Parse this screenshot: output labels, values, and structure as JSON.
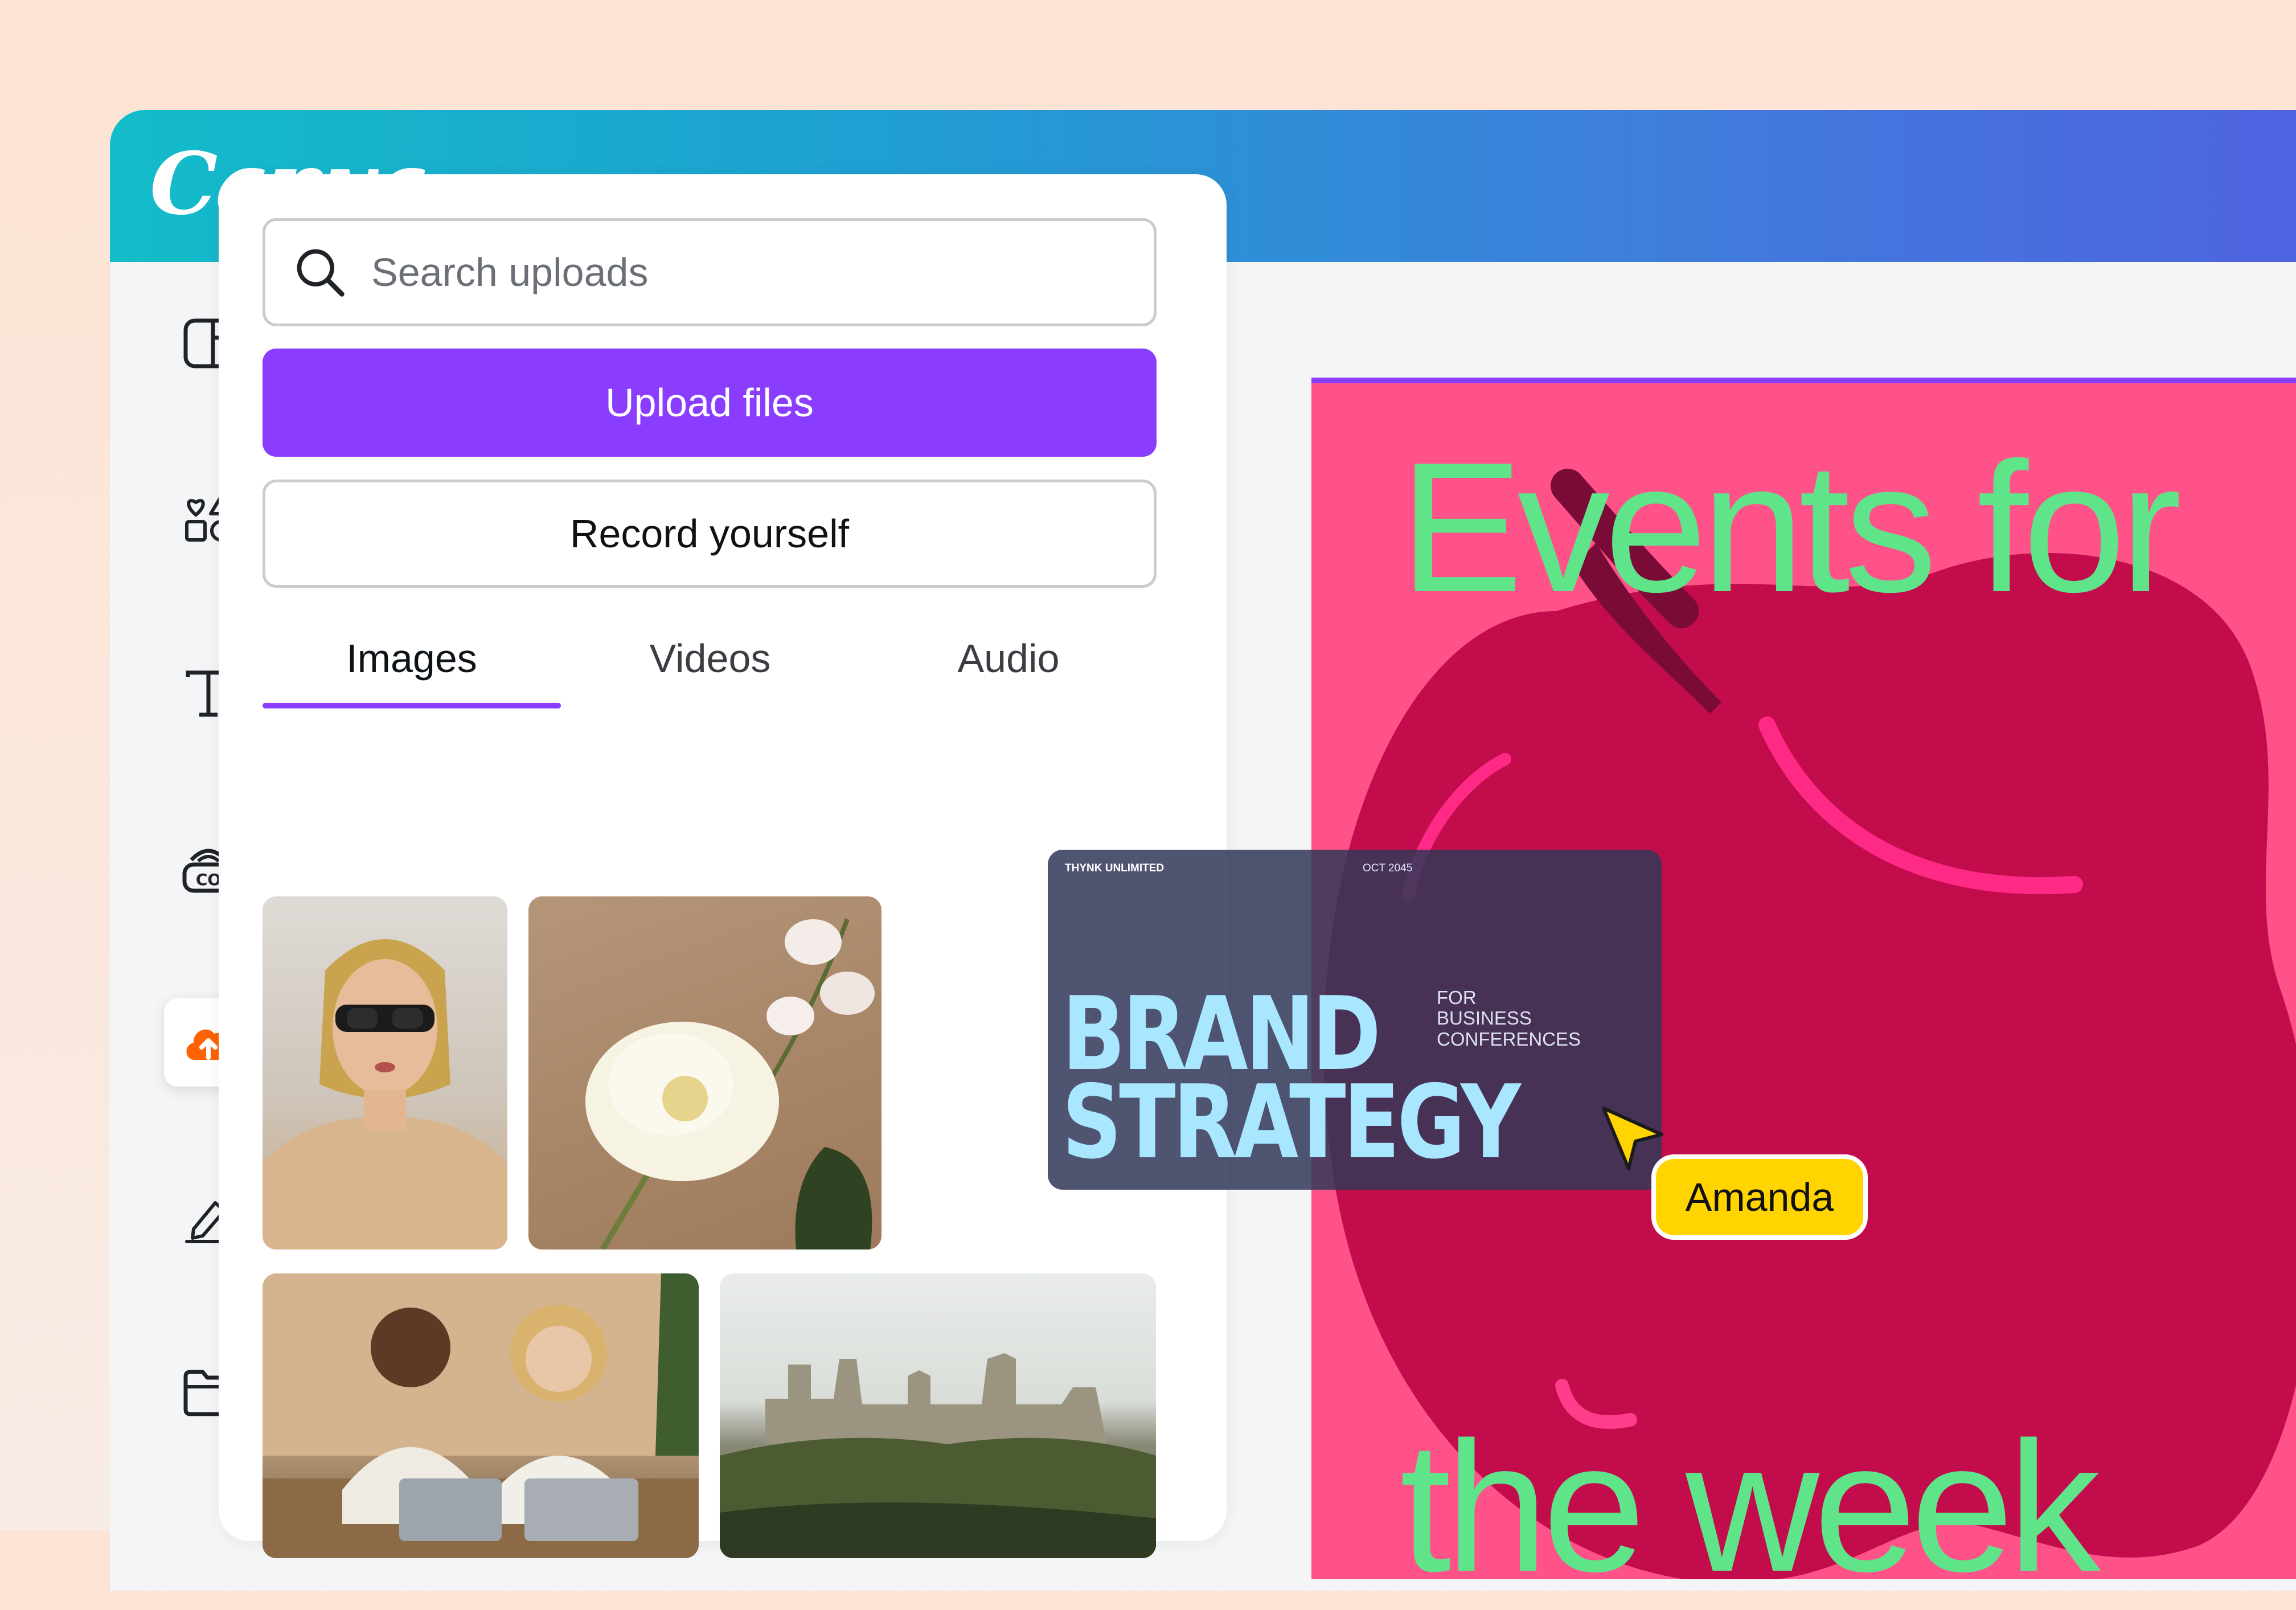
{
  "app": {
    "logo_text": "Canva"
  },
  "sidebar": {
    "items": [
      {
        "icon": "layout-icon"
      },
      {
        "icon": "elements-icon"
      },
      {
        "icon": "text-icon"
      },
      {
        "icon": "brand-icon"
      },
      {
        "icon": "uploads-icon",
        "active": true
      },
      {
        "icon": "draw-icon"
      },
      {
        "icon": "projects-icon"
      }
    ]
  },
  "uploads_panel": {
    "search": {
      "placeholder": "Search uploads",
      "value": ""
    },
    "upload_button": "Upload files",
    "record_button": "Record yourself",
    "tabs": [
      {
        "label": "Images",
        "active": true
      },
      {
        "label": "Videos",
        "active": false
      },
      {
        "label": "Audio",
        "active": false
      }
    ]
  },
  "canvas": {
    "title_line1": "Events for",
    "title_line2": "the week"
  },
  "brand_card": {
    "company": "THYNK UNLIMITED",
    "date": "OCT 2045",
    "line1": "BRAND",
    "line2": "STRATEGY",
    "sub_line1": "FOR",
    "sub_line2": "BUSINESS",
    "sub_line3": "CONFERENCES"
  },
  "collaborator": {
    "name": "Amanda"
  },
  "colors": {
    "accent": "#8b3dff",
    "canvas_bg": "#fe5289",
    "title_green": "#5fe48a",
    "upload_icon": "#ff6105",
    "collaborator_badge": "#ffd400"
  }
}
